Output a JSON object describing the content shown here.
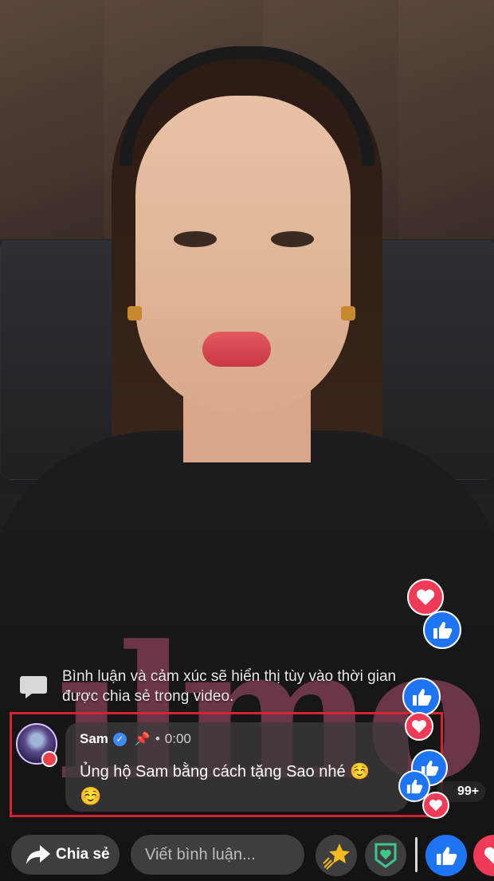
{
  "notice": {
    "text_line1": "Bình luận và cảm xúc sẽ hiển thị tùy vào thời gian",
    "text_line2": "được chia sẻ trong video."
  },
  "comment": {
    "author": "Sam",
    "verified": true,
    "pinned": true,
    "separator": "•",
    "timestamp": "0:00",
    "text": "Ủng hộ Sam bằng cách tặng Sao nhé ☺️",
    "extra_emoji": "☺️"
  },
  "reactions": {
    "count_label": "99+"
  },
  "bottom_bar": {
    "share_label": "Chia sẻ",
    "comment_placeholder": "Viết bình luận...",
    "icons": [
      "share-arrow-icon",
      "stars-icon",
      "supporter-badge-icon",
      "like-icon",
      "love-icon"
    ]
  },
  "colors": {
    "highlight_box": "#d3242f",
    "like_blue": "#1e74f2",
    "love_red": "#ef3b57",
    "verified_blue": "#3d8bf2",
    "star_gold": "#f5b921"
  }
}
